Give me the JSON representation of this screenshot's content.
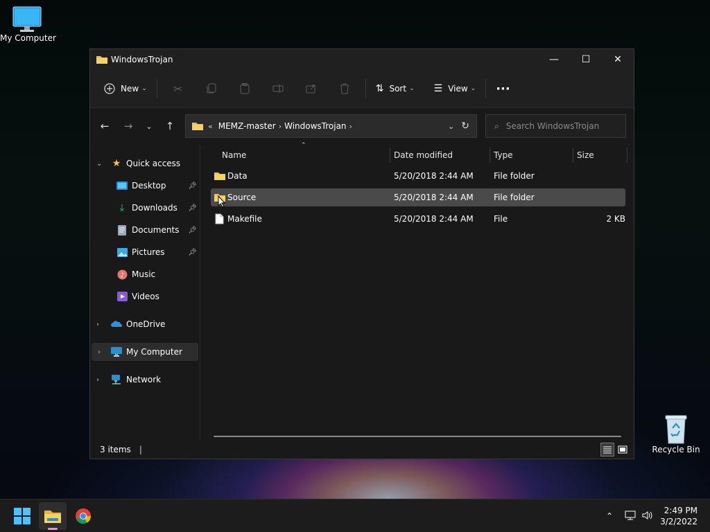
{
  "desktop": {
    "icons": [
      {
        "label": "My Computer"
      },
      {
        "label": "Recycle Bin"
      }
    ]
  },
  "window": {
    "title": "WindowsTrojan",
    "controls": {
      "minimize": "—",
      "maximize": "☐",
      "close": "✕"
    }
  },
  "toolbar": {
    "new_label": "New",
    "sort_label": "Sort",
    "view_label": "View",
    "more_label": "···"
  },
  "address": {
    "overflow": "«",
    "crumbs": [
      "MEMZ-master",
      "WindowsTrojan"
    ]
  },
  "search": {
    "placeholder": "Search WindowsTrojan"
  },
  "sidebar": {
    "quick_access": "Quick access",
    "items": [
      {
        "label": "Desktop",
        "pinned": true
      },
      {
        "label": "Downloads",
        "pinned": true
      },
      {
        "label": "Documents",
        "pinned": true
      },
      {
        "label": "Pictures",
        "pinned": true
      },
      {
        "label": "Music",
        "pinned": false
      },
      {
        "label": "Videos",
        "pinned": false
      }
    ],
    "onedrive": "OneDrive",
    "my_computer": "My Computer",
    "network": "Network"
  },
  "columns": {
    "name": "Name",
    "date": "Date modified",
    "type": "Type",
    "size": "Size"
  },
  "files": [
    {
      "name": "Data",
      "date": "5/20/2018 2:44 AM",
      "type": "File folder",
      "size": ""
    },
    {
      "name": "Source",
      "date": "5/20/2018 2:44 AM",
      "type": "File folder",
      "size": ""
    },
    {
      "name": "Makefile",
      "date": "5/20/2018 2:44 AM",
      "type": "File",
      "size": "2 KB"
    }
  ],
  "status": {
    "count": "3 items",
    "cursor": "|"
  },
  "taskbar": {
    "time": "2:49 PM",
    "date": "3/2/2022"
  },
  "colors": {
    "folder": "#f0c24b",
    "accent": "#4cc2ff",
    "selection": "#4a4a4a"
  }
}
